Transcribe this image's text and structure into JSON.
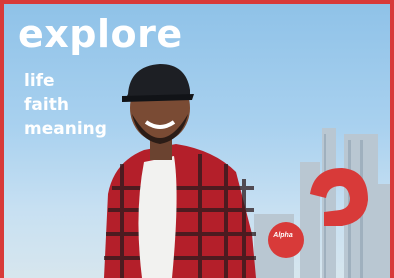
{
  "headline": "explore",
  "sublines": [
    "life",
    "faith",
    "meaning"
  ],
  "brand": {
    "logo_text": "Alpha",
    "icon": "question-mark-logo-icon",
    "color": "#d83a39"
  },
  "colors": {
    "frame": "#d83a39",
    "sky": "#a9d1ef",
    "text": "#ffffff"
  }
}
